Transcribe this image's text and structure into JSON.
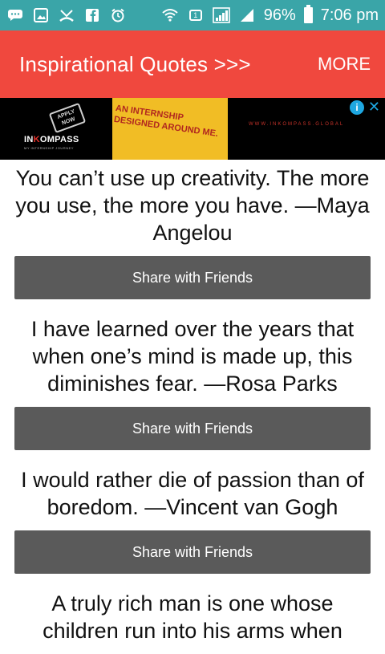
{
  "status_bar": {
    "battery": "96%",
    "time": "7:06 pm",
    "sim_label": "1",
    "left_icons": [
      "chat-icon",
      "image-icon",
      "missed-call-icon",
      "facebook-icon",
      "alarm-icon"
    ],
    "right_icons": [
      "wifi-icon",
      "sim-icon",
      "signal-icon",
      "signal-icon",
      "battery-icon"
    ]
  },
  "app_bar": {
    "title": "Inspirational Quotes >>>",
    "more_label": "MORE",
    "color": "#f0483e"
  },
  "ad": {
    "stamp_text": "APPLY NOW",
    "brand_prefix": "IN",
    "brand_accent": "K",
    "brand_suffix": "OMPASS",
    "brand_tagline": "MY INTERNSHIP JOURNEY",
    "headline": "AN INTERNSHIP DESIGNED AROUND ME.",
    "url": "WWW.INKOMPASS.GLOBAL",
    "info_icon": "info-icon",
    "close_icon": "close-icon"
  },
  "quotes": [
    {
      "text": "You can’t use up creativity. The more you use, the more you have. —Maya Angelou",
      "share_label": "Share with Friends"
    },
    {
      "text": "I have learned over the years that when one’s mind is made up, this diminishes fear. —Rosa Parks",
      "share_label": "Share with Friends"
    },
    {
      "text": "I would rather die of passion than of boredom. —Vincent van Gogh",
      "share_label": "Share with Friends"
    },
    {
      "text": "A truly rich man is one whose children run into his arms when",
      "share_label": ""
    }
  ]
}
